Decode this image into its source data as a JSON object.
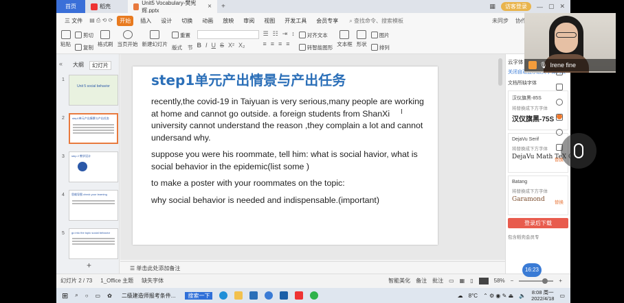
{
  "tabs": {
    "home": "首页",
    "daoke": "稻壳",
    "doc": "Unit5 Vocabulary-樊宪辉.pptx",
    "login": "访客登录"
  },
  "menu": {
    "file": "三 文件",
    "items": [
      "开始",
      "插入",
      "设计",
      "切换",
      "动画",
      "放映",
      "审阅",
      "视图",
      "开发工具",
      "会员专享"
    ],
    "search": "查找命令、搜索模板",
    "sync": "未同步",
    "collab": "协作"
  },
  "toolbar": {
    "paste": "粘贴",
    "cut": "剪切",
    "copy": "复制",
    "format_painter": "格式刷",
    "start_from_current": "当页开始",
    "new_slide": "新建幻灯片",
    "layout": "版式",
    "section": "节",
    "reset": "重置",
    "align_text": "对齐文本",
    "smart_graphic": "转智能图形",
    "textbox": "文本框",
    "shape": "形状",
    "picture": "图片",
    "arrange": "排列"
  },
  "left_panel": {
    "outline_tab": "大纲",
    "slides_tab": "幻灯片",
    "thumbs": [
      {
        "num": "1",
        "title": "Unit 5 social behavior"
      },
      {
        "num": "2",
        "title": "step1单元产出情景与产出任务"
      },
      {
        "num": "3",
        "title": "step 2 教学设计"
      },
      {
        "num": "4",
        "title": "思维导图 check your learning"
      },
      {
        "num": "5",
        "title": "go into the topic social behavior"
      }
    ]
  },
  "slide": {
    "title": "step1单元产出情景与产出任务",
    "paragraphs": [
      "recently,the covid-19 in Taiyuan is very serious,many people are working at home and cannot go outside. a foreign students from ShanXi university cannot understand the reason ,they complain a lot and cannot undersand why.",
      "suppose you were his roommate, tell him: what is social havior, what is social behavior in the epidemic(list some )",
      "  to make a poster with your roommates on the topic:",
      "why social behavior is needed and indispensable.(important)"
    ]
  },
  "notes": {
    "placeholder": "单击此处添加备注"
  },
  "right_panel": {
    "title": "云字体",
    "link": "关闭自动显示缺失字体列表",
    "section": "文档所缺字体",
    "fonts": [
      {
        "name": "汉仪旗黑-85S",
        "hint": "将替换成下方字体",
        "replacement": "汉仪旗黑-75S"
      },
      {
        "name": "DejaVu Serif",
        "hint": "将替换成下方字体",
        "replacement": "DejaVu Math TeX Gyre",
        "action": "替换"
      },
      {
        "name": "Batang",
        "hint": "将替换成下方字体",
        "replacement": "Garamond",
        "action": "替换"
      }
    ],
    "download": "登录后下载",
    "footer": "包含稻壳会员专"
  },
  "statusbar": {
    "slide_info": "幻灯片 2 / 73",
    "theme": "1_Office 主题",
    "missing_font": "缺失字体",
    "beautify": "智能美化",
    "notes": "备注",
    "comments": "批注",
    "zoom": "58%"
  },
  "taskbar": {
    "app1": "二级建造师报考条件...",
    "app2": "搜索一下",
    "weather": "8°C",
    "time": "8:08 周一",
    "date": "2022/4/18"
  },
  "overlay": {
    "presenter": "Irene fine",
    "timer": "16:23"
  }
}
